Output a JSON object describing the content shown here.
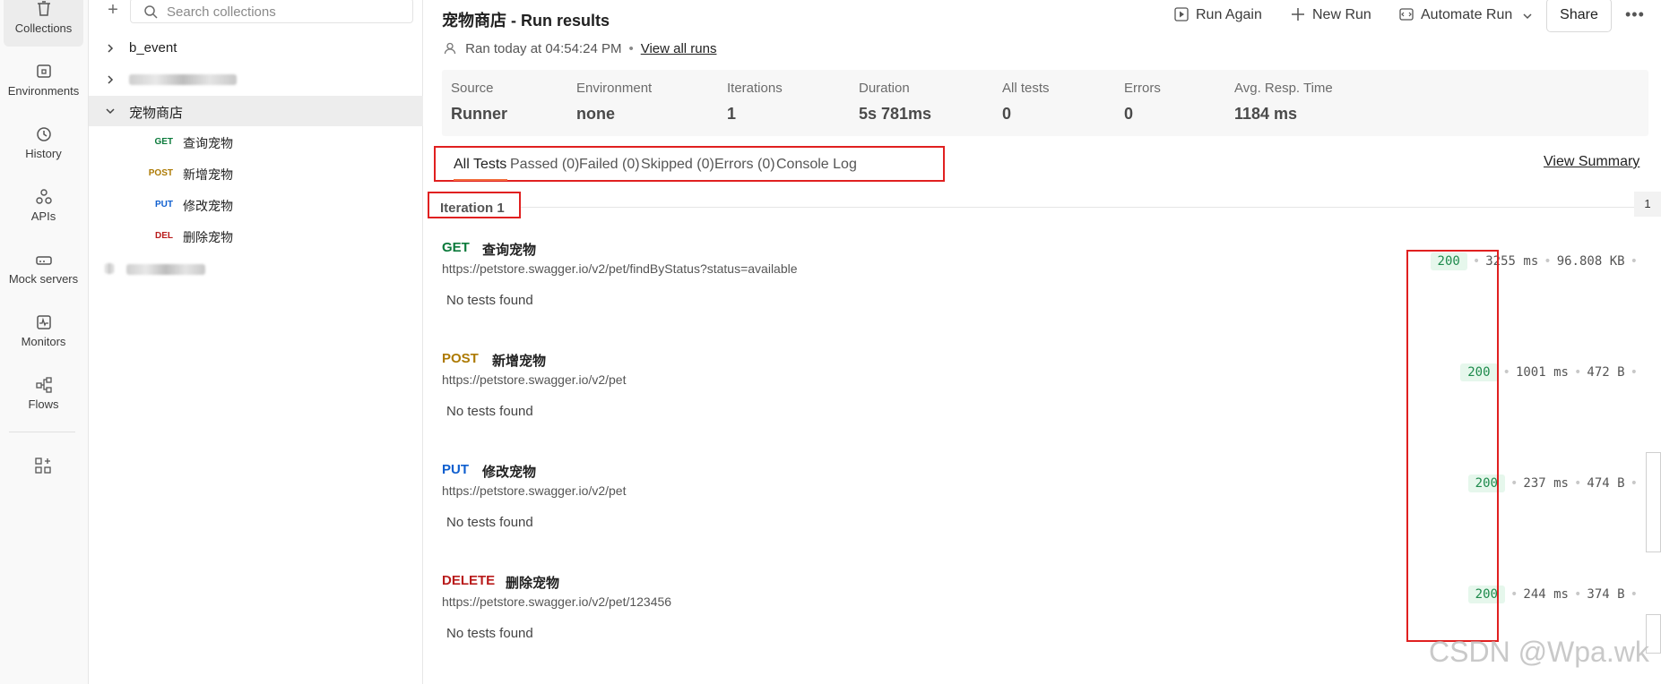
{
  "rail": {
    "items": [
      {
        "label": "Collections",
        "icon": "trash-can-icon"
      },
      {
        "label": "Environments",
        "icon": "environment-icon"
      },
      {
        "label": "History",
        "icon": "history-icon"
      },
      {
        "label": "APIs",
        "icon": "apis-icon"
      },
      {
        "label": "Mock servers",
        "icon": "mock-server-icon"
      },
      {
        "label": "Monitors",
        "icon": "monitor-icon"
      },
      {
        "label": "Flows",
        "icon": "flows-icon"
      }
    ],
    "extra_icon": "add-widgets-icon"
  },
  "sidebar": {
    "search_placeholder": "Search collections",
    "tree": [
      {
        "label": "b_event"
      },
      {
        "label": "宠物商店"
      }
    ],
    "requests": [
      {
        "method": "GET",
        "name": "查询宠物",
        "color": "#0b7a3b"
      },
      {
        "method": "POST",
        "name": "新增宠物",
        "color": "#ad7a03"
      },
      {
        "method": "PUT",
        "name": "修改宠物",
        "color": "#0f5fcf"
      },
      {
        "method": "DEL",
        "name": "删除宠物",
        "color": "#b91c1c"
      }
    ]
  },
  "header": {
    "title": "宠物商店 - Run results",
    "ran_text": "Ran today at 04:54:24 PM",
    "view_all_runs": "View all runs",
    "run_again": "Run Again",
    "new_run": "New Run",
    "automate_run": "Automate Run",
    "share": "Share",
    "more": "•••"
  },
  "stats": [
    {
      "label": "Source",
      "value": "Runner"
    },
    {
      "label": "Environment",
      "value": "none"
    },
    {
      "label": "Iterations",
      "value": "1"
    },
    {
      "label": "Duration",
      "value": "5s 781ms"
    },
    {
      "label": "All tests",
      "value": "0"
    },
    {
      "label": "Errors",
      "value": "0"
    },
    {
      "label": "Avg. Resp. Time",
      "value": "1184 ms"
    }
  ],
  "tabs": [
    {
      "label": "All Tests"
    },
    {
      "label": "Passed (0)"
    },
    {
      "label": "Failed (0)"
    },
    {
      "label": "Skipped (0)"
    },
    {
      "label": "Errors (0)"
    },
    {
      "label": "Console Log"
    }
  ],
  "view_summary": "View Summary",
  "iteration_label": "Iteration 1",
  "iteration_counter": "1",
  "results": [
    {
      "method": "GET",
      "color": "#0b7a3b",
      "name": "查询宠物",
      "url": "https://petstore.swagger.io/v2/pet/findByStatus?status=available",
      "status": "200",
      "time": "3255 ms",
      "size": "96.808 KB",
      "note": "No tests found"
    },
    {
      "method": "POST",
      "color": "#ad7a03",
      "name": "新增宠物",
      "url": "https://petstore.swagger.io/v2/pet",
      "status": "200",
      "time": "1001 ms",
      "size": "472 B",
      "note": "No tests found"
    },
    {
      "method": "PUT",
      "color": "#0f5fcf",
      "name": "修改宠物",
      "url": "https://petstore.swagger.io/v2/pet",
      "status": "200",
      "time": "237 ms",
      "size": "474 B",
      "note": "No tests found"
    },
    {
      "method": "DELETE",
      "color": "#b91c1c",
      "name": "删除宠物",
      "url": "https://petstore.swagger.io/v2/pet/123456",
      "status": "200",
      "time": "244 ms",
      "size": "374 B",
      "note": "No tests found"
    }
  ],
  "watermark": "CSDN @Wpa.wk"
}
